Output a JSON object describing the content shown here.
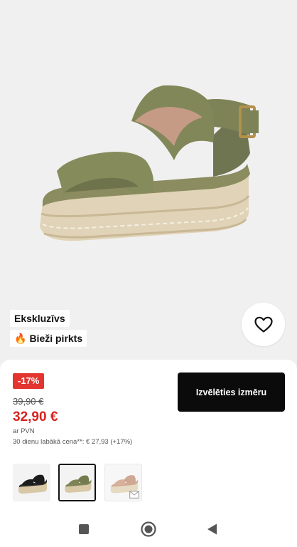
{
  "product": {
    "tags": {
      "exclusive": "Ekskluzīvs",
      "popular": "Bieži pirkts",
      "popular_icon": "fire-icon"
    },
    "wishlist_icon": "heart-icon"
  },
  "pricing": {
    "discount_badge": "-17%",
    "old_price": "39,90 €",
    "new_price": "32,90 €",
    "vat_note": "ar PVN",
    "lowest_price_note": "30 dienu labākā cena**: € 27,93 (+17%)"
  },
  "actions": {
    "select_size_label": "Izvēlēties izmēru"
  },
  "thumbnails": [
    {
      "color": "black"
    },
    {
      "color": "khaki",
      "selected": true
    },
    {
      "color": "beige"
    }
  ],
  "colors": {
    "sale_red": "#d6231f",
    "badge_red": "#e3342f",
    "button_black": "#0b0b0b",
    "khaki": "#7f8458"
  }
}
